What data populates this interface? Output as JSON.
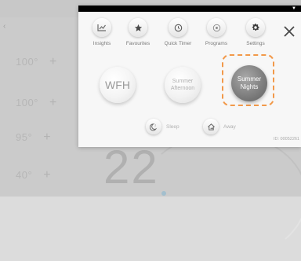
{
  "background": {
    "temps": [
      "100°",
      "100°",
      "95°",
      "40°"
    ],
    "plus_symbol": "+",
    "big_number": "22"
  },
  "panel": {
    "nav": [
      {
        "label": "Insights",
        "icon": "insights-chart-icon"
      },
      {
        "label": "Favourites",
        "icon": "star-icon"
      },
      {
        "label": "Quick Timer",
        "icon": "clock-icon"
      },
      {
        "label": "Programs",
        "icon": "programs-icon"
      },
      {
        "label": "Settings",
        "icon": "gear-icon"
      }
    ],
    "close_icon": "close-icon",
    "scenes": [
      {
        "label": "WFH"
      },
      {
        "label": "Summer Afternoon"
      },
      {
        "label": "Summer Nights",
        "selected": true
      }
    ],
    "modes": [
      {
        "label": "Sleep",
        "icon": "sleep-icon"
      },
      {
        "label": "Away",
        "icon": "home-away-icon"
      }
    ],
    "device_id": "ID: 00052261"
  },
  "colors": {
    "highlight": "#f2994a",
    "selected_scene": "#7f7f7f"
  }
}
